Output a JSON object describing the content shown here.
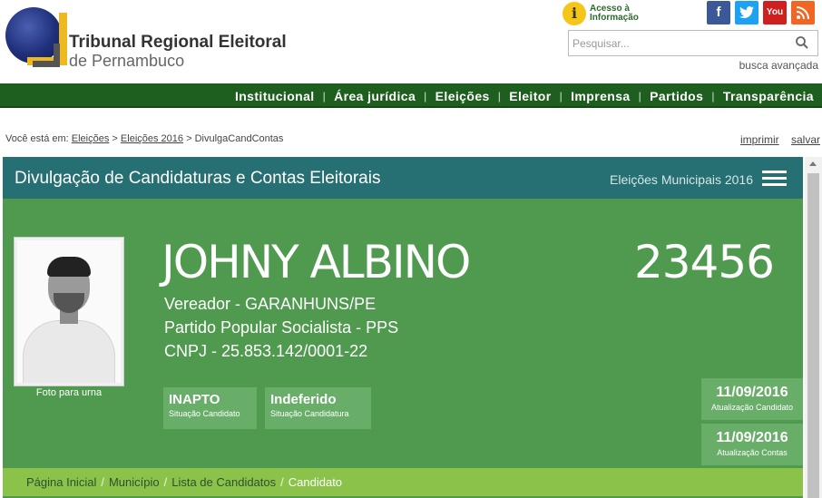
{
  "header": {
    "logo_title": "Tribunal Regional Eleitoral",
    "logo_subtitle": "de Pernambuco",
    "acesso_line1": "Acesso à",
    "acesso_line2": "Informação",
    "acesso_icon": "i",
    "social": {
      "facebook": "f",
      "twitter": "t",
      "youtube": "You",
      "rss": "rss"
    },
    "search_placeholder": "Pesquisar...",
    "advanced_search": "busca avançada"
  },
  "nav": {
    "items": [
      "Institucional",
      "Área jurídica",
      "Eleições",
      "Eleitor",
      "Imprensa",
      "Partidos",
      "Transparência"
    ],
    "separator": "|",
    "color": "#1e5e1e"
  },
  "breadcrumb": {
    "prefix": "Você está em:",
    "items": [
      "Eleições",
      "Eleições 2016"
    ],
    "sep": ">",
    "current": "DivulgaCandContas"
  },
  "tools": {
    "print": "imprimir",
    "save": "salvar"
  },
  "panel": {
    "title": "Divulgação de Candidaturas e Contas Eleitorais",
    "election": "Eleições Municipais 2016",
    "photo_caption": "Foto para urna",
    "candidate_name": "JOHNY ALBINO",
    "candidate_number": "23456",
    "office": "Vereador - GARANHUNS/PE",
    "party": "Partido Popular Socialista - PPS",
    "cnpj": "CNPJ - 25.853.142/0001-22",
    "status_candidate": "INAPTO",
    "status_candidate_label": "Situação Candidato",
    "status_candidacy": "Indeferido",
    "status_candidacy_label": "Situação Candidatura",
    "update_candidate_date": "11/09/2016",
    "update_candidate_label": "Atualização Candidato",
    "update_accounts_date": "11/09/2016",
    "update_accounts_label": "Atualização Contas",
    "header_color": "#266f73",
    "body_color": "#4f9a4f"
  },
  "subnav": {
    "items": [
      "Página Inicial",
      "Município",
      "Lista de Candidatos"
    ],
    "sep": "/",
    "current": "Candidato",
    "color": "#8bc34a"
  }
}
